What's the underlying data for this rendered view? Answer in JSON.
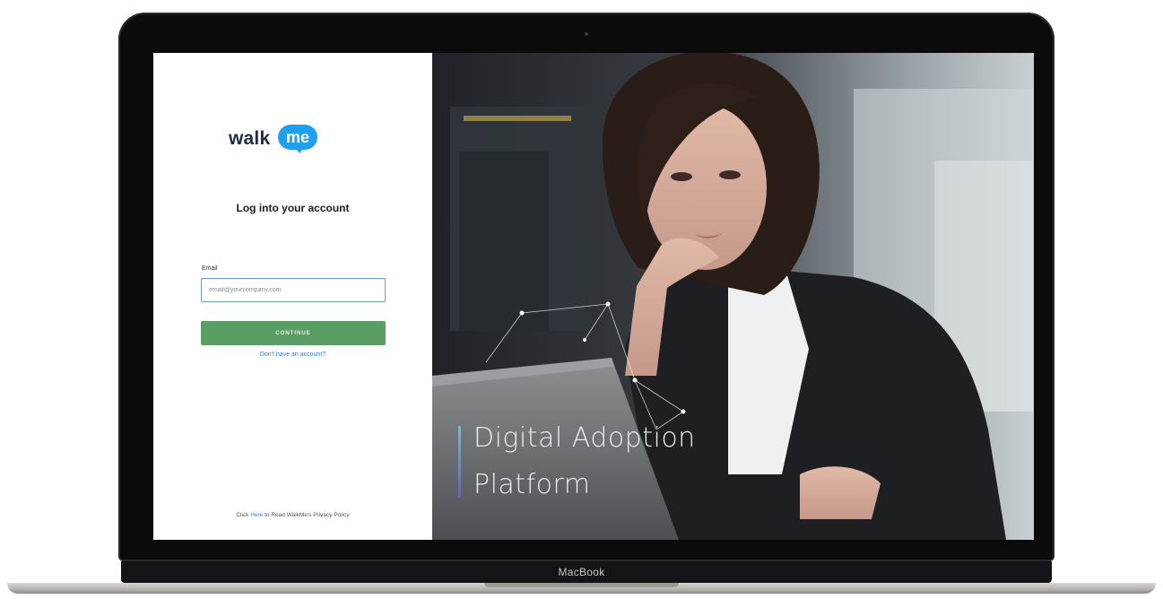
{
  "device": {
    "label": "MacBook"
  },
  "login": {
    "logo": {
      "word": "walk",
      "badge": "me",
      "brand_color": "#1f9ff0"
    },
    "title": "Log into your account",
    "email": {
      "label": "Email",
      "placeholder": "email@yourcompany.com",
      "value": ""
    },
    "continue_label": "CONTINUE",
    "signup_link": "Don't have an account?",
    "privacy": {
      "prefix": "Click",
      "link": "Here",
      "suffix": "to Read WalkMe's Privacy Policy"
    },
    "accent_color": "#5a9e66"
  },
  "hero": {
    "headline_line1": "Digital Adoption",
    "headline_line2": "Platform"
  }
}
